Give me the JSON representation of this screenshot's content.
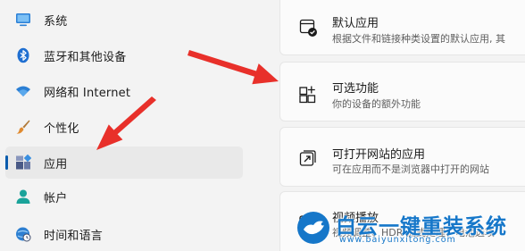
{
  "sidebar": {
    "items": [
      {
        "label": "系统",
        "icon": "monitor-icon"
      },
      {
        "label": "蓝牙和其他设备",
        "icon": "bluetooth-icon"
      },
      {
        "label": "网络和 Internet",
        "icon": "wifi-icon"
      },
      {
        "label": "个性化",
        "icon": "brush-icon"
      },
      {
        "label": "应用",
        "icon": "apps-icon",
        "active": true
      },
      {
        "label": "帐户",
        "icon": "person-icon"
      },
      {
        "label": "时间和语言",
        "icon": "globe-clock-icon"
      }
    ]
  },
  "main": {
    "cards": [
      {
        "title": "默认应用",
        "subtitle": "根据文件和链接种类设置的默认应用, 其",
        "icon": "default-apps-icon"
      },
      {
        "title": "可选功能",
        "subtitle": "你的设备的额外功能",
        "icon": "optional-features-icon"
      },
      {
        "title": "可打开网站的应用",
        "subtitle": "可在应用而不是浏览器中打开的网站",
        "icon": "open-in-app-icon"
      },
      {
        "title": "视频播放",
        "subtitle": "视频调整、HDR 流式处理、电池选项",
        "icon": "video-playback-icon"
      }
    ]
  },
  "watermark": {
    "text": "白云一键重装系统",
    "url": "www.baiyunxitong.com"
  },
  "colors": {
    "accent": "#0a5cad",
    "arrow": "#e8302a",
    "watermark": "#1677c9"
  }
}
